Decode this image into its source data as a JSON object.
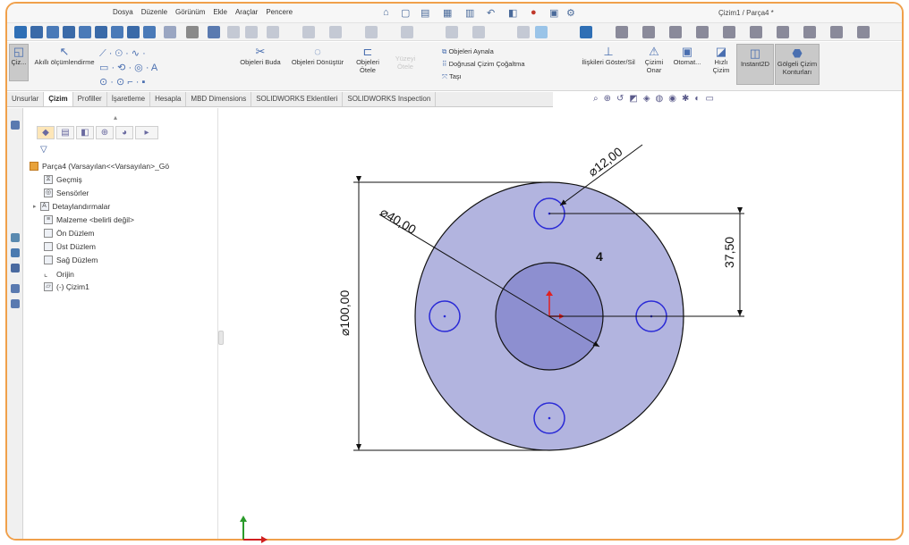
{
  "menu": [
    "Dosya",
    "Düzenle",
    "Görünüm",
    "Ekle",
    "Araçlar",
    "Pencere"
  ],
  "document_title": "Çizim1 / Parça4 *",
  "commands": {
    "sketch": "Çiz...",
    "smart_dimension": "Akıllı ölçümlendirme",
    "trim": "Objeleri Buda",
    "convert": "Objeleri Dönüştür",
    "offset_line1": "Objeleri",
    "offset_line2": "Ötele",
    "offset_surface_line1": "Yüzeyi",
    "offset_surface_line2": "Ötele",
    "mirror": "Objeleri Aynala",
    "linear_pattern": "Doğrusal Çizim Çoğaltma",
    "move": "Taşı",
    "relations": "İlişkileri Göster/Sil",
    "repair_line1": "Çizimi",
    "repair_line2": "Onar",
    "auto": "Otomat...",
    "quick_line1": "Hızlı",
    "quick_line2": "Çizim",
    "instant2d": "Instant2D",
    "shaded_line1": "Gölgeli Çizim",
    "shaded_line2": "Konturları"
  },
  "tabs": [
    "Unsurlar",
    "Çizim",
    "Profiller",
    "İşaretleme",
    "Hesapla",
    "MBD Dimensions",
    "SOLIDWORKS Eklentileri",
    "SOLIDWORKS Inspection"
  ],
  "tree": {
    "root": "Parça4  (Varsayılan<<Varsayılan>_Gö",
    "items": [
      "Geçmiş",
      "Sensörler",
      "Detaylandırmalar",
      "Malzeme <belirli değil>",
      "Ön Düzlem",
      "Üst Düzlem",
      "Sağ Düzlem",
      "Orijin",
      "(-) Çizim1"
    ]
  },
  "drawing": {
    "dim_outer": "⌀100,00",
    "dim_center": "⌀40,00",
    "dim_hole": "⌀12,00",
    "dim_offset": "37,50",
    "pattern_count": "4",
    "colors": {
      "outer_fill": "#b2b4df",
      "inner_fill": "#8d8fd0",
      "hole_stroke": "#2a2ad6",
      "frame": "#f0a04b"
    }
  }
}
